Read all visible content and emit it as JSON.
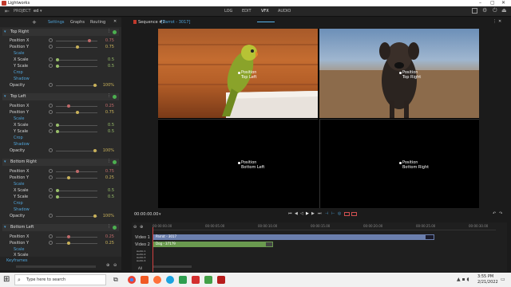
{
  "app": {
    "title": "Lightworks"
  },
  "menu": {
    "project_label": "PROJECT",
    "project_name": "ed",
    "tabs": [
      "LOG",
      "EDIT",
      "VFX",
      "AUDIO"
    ],
    "active_tab": "VFX"
  },
  "left_tabs": {
    "add": "+",
    "settings": "Settings",
    "graphs": "Graphs",
    "routing": "Routing"
  },
  "sections": [
    {
      "title": "Top Right",
      "pos_x": "0.75",
      "pos_y": "0.75",
      "x_scale": "0.5",
      "y_scale": "0.5",
      "opacity": "100%"
    },
    {
      "title": "Top Left",
      "pos_x": "0.25",
      "pos_y": "0.75",
      "x_scale": "0.5",
      "y_scale": "0.5",
      "opacity": "100%"
    },
    {
      "title": "Bottom Right",
      "pos_x": "0.75",
      "pos_y": "0.25",
      "x_scale": "0.5",
      "y_scale": "0.5",
      "opacity": "100%"
    },
    {
      "title": "Bottom Left",
      "pos_x": "0.25",
      "pos_y": "0.25"
    }
  ],
  "labels": {
    "position_x": "Position X",
    "position_y": "Position Y",
    "scale": "Scale",
    "x_scale": "X Scale",
    "y_scale": "Y Scale",
    "crop": "Crop",
    "shadow": "Shadow",
    "opacity": "Opacity",
    "keyframes": "Keyframes"
  },
  "viewer": {
    "sequence_title": "Sequence #1",
    "sequence_sub": "[Parrot - 3017]",
    "position_word": "Position",
    "quads": [
      "Top Left",
      "Top Right",
      "Bottom Left",
      "Bottom Right"
    ],
    "timecode": "00:00:00.00"
  },
  "timeline": {
    "ruler": [
      "00:00:00.00",
      "00:00:05.00",
      "00:00:10.00",
      "00:00:15.00",
      "00:00:20.00",
      "00:00:25.00",
      "00:00:30.00"
    ],
    "tracks": [
      "Video 1",
      "Video 2",
      "Audio 1",
      "Audio 2",
      "Audio 3",
      "Audio 4"
    ],
    "clip1": "Parrot - 3017",
    "clip2": "Dog - 37179",
    "all": "All"
  },
  "taskbar": {
    "search_placeholder": "Type here to search",
    "time": "3:55 PM",
    "date": "2/21/2022"
  }
}
